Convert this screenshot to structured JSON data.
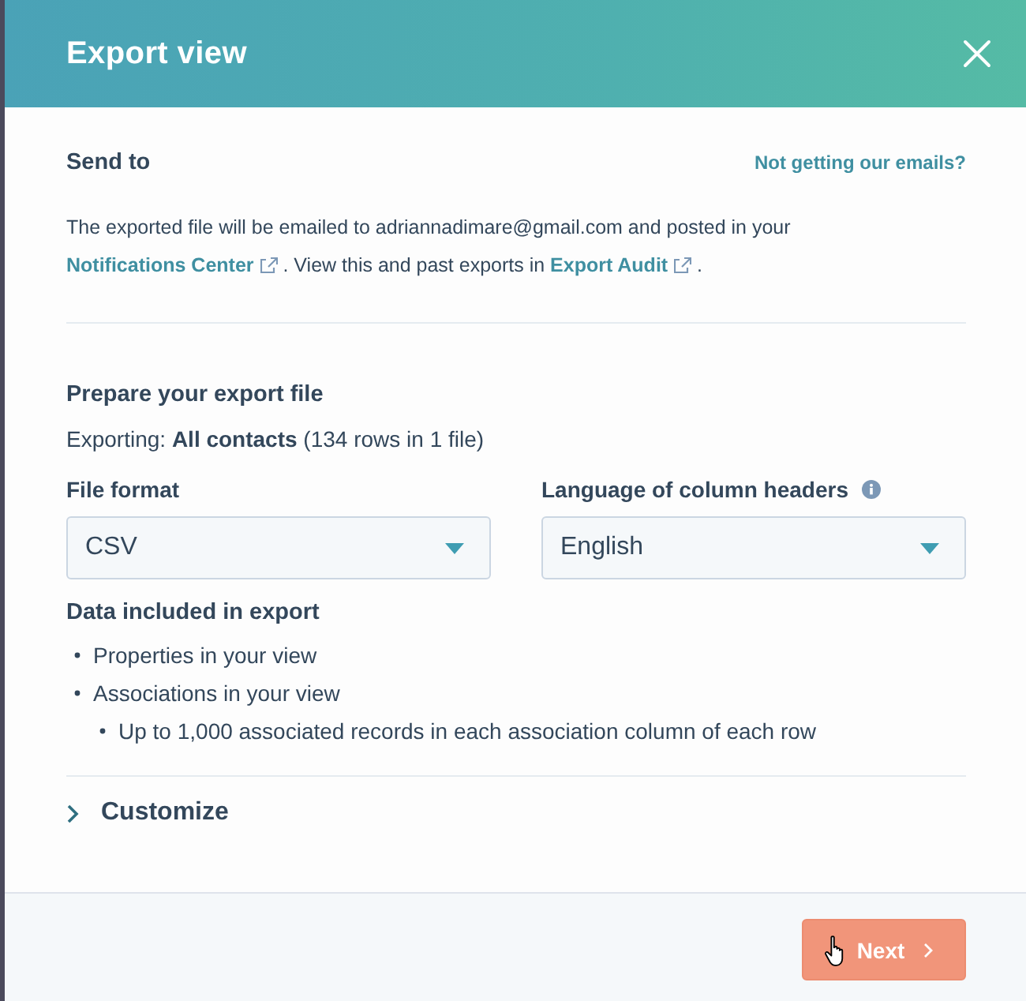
{
  "dialog": {
    "title": "Export view"
  },
  "send_to": {
    "heading": "Send to",
    "help_link": "Not getting our emails?",
    "message": [
      {
        "kind": "text",
        "text": "The exported file will be emailed to adriannadimare@gmail.com and posted in your "
      },
      {
        "kind": "link",
        "text": "Notifications Center"
      },
      {
        "kind": "text",
        "text": " . View this and past exports in "
      },
      {
        "kind": "link",
        "text": "Export Audit"
      },
      {
        "kind": "text",
        "text": " ."
      }
    ]
  },
  "prepare": {
    "heading": "Prepare your export file",
    "exporting": "Exporting: **All contacts** (134 rows in 1 file)"
  },
  "fields": [
    {
      "label": "File format",
      "value": "CSV",
      "info": false
    },
    {
      "label": "Language of column headers",
      "value": "English",
      "info": true
    }
  ],
  "data_included": {
    "heading": "Data included in export",
    "items": [
      {
        "text": "Properties in your view"
      },
      {
        "text": "Associations in your view",
        "children": [
          {
            "text": "Up to 1,000 associated records in each association column of each row"
          }
        ]
      }
    ]
  },
  "customize": {
    "label": "Customize",
    "expanded": false
  },
  "footer": {
    "next_button": "Next"
  }
}
